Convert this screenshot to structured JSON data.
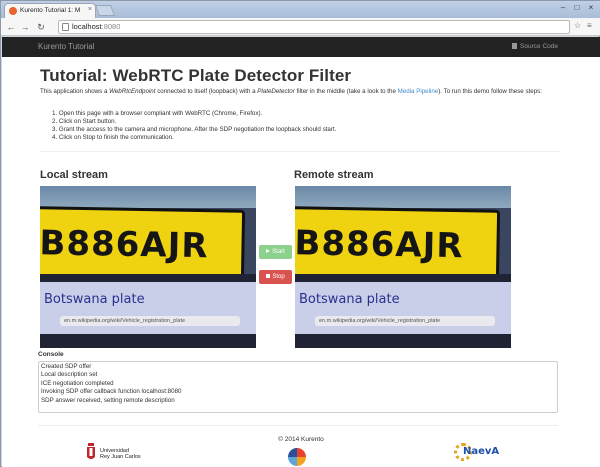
{
  "browser": {
    "tab_title": "Kurento Tutorial 1: M",
    "tab_close": "×",
    "url_host": "localhost",
    "url_port": ":8080",
    "nav": {
      "back": "←",
      "forward": "→",
      "reload": "↻",
      "star": "☆",
      "menu": "≡"
    },
    "window_controls": {
      "minimize": "–",
      "maximize": "□",
      "close": "×"
    }
  },
  "navbar": {
    "brand": "Kurento Tutorial",
    "source_code": "Source Code"
  },
  "page": {
    "title": "Tutorial: WebRTC Plate Detector Filter",
    "intro": {
      "p1": "This application shows a ",
      "e1": "WebRtcEndpoint",
      "p2": " connected to itself (loopback) with a ",
      "e2": "PlateDetector",
      "p3": " filter in the middle (take a look to the ",
      "link": "Media Pipeline",
      "p4": "). To run this demo follow these steps:"
    },
    "steps": [
      "1. Open this page with a browser compliant with WebRTC (Chrome, Firefox).",
      "2. Click on Start button.",
      "3. Grant the access to the camera and microphone. After the SDP negotiation the loopback should start.",
      "4. Click on Stop to finish the communication."
    ],
    "local_stream_title": "Local stream",
    "remote_stream_title": "Remote stream",
    "video": {
      "plate": "B886AJR",
      "caption": "Botswana plate",
      "url": "en.m.wikipedia.org/wiki/Vehicle_registration_plate"
    },
    "buttons": {
      "start": "Start",
      "stop": "Stop"
    },
    "console_label": "Console",
    "console_lines": [
      "Created SDP offer",
      "Local description set",
      "ICE negotiation completed",
      "Invoking SDP offer callback function localhost:8080",
      "SDP answer received, setting remote description"
    ],
    "copyright": "© 2014 Kurento",
    "logos": {
      "urjc_line1": "Universidad",
      "urjc_line2": "Rey Juan Carlos",
      "naeva": "NaevA"
    }
  },
  "colors": {
    "navbar": "#222222",
    "link": "#428bca",
    "start_button": "#8cd18c",
    "stop_button": "#d9534f",
    "plate_yellow": "#f0d310"
  }
}
